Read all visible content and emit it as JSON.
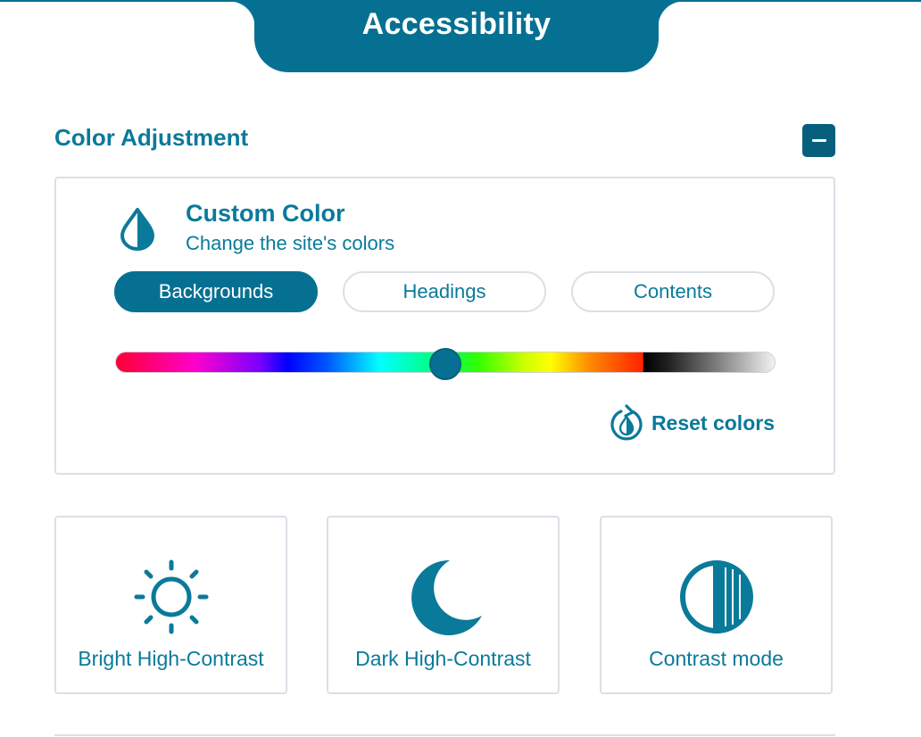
{
  "header": {
    "title": "Accessibility"
  },
  "section": {
    "title": "Color Adjustment"
  },
  "custom_color": {
    "title": "Custom Color",
    "subtitle": "Change the site's colors",
    "tabs": [
      {
        "label": "Backgrounds",
        "active": true
      },
      {
        "label": "Headings",
        "active": false
      },
      {
        "label": "Contents",
        "active": false
      }
    ],
    "slider_value": 0.5,
    "reset_label": "Reset colors"
  },
  "modes": [
    {
      "label": "Bright High-Contrast",
      "icon": "sun-icon"
    },
    {
      "label": "Dark High-Contrast",
      "icon": "moon-icon"
    },
    {
      "label": "Contrast mode",
      "icon": "contrast-icon"
    }
  ],
  "colors": {
    "accent": "#067092",
    "text": "#0a7a9a",
    "border": "#dcdfe6"
  }
}
